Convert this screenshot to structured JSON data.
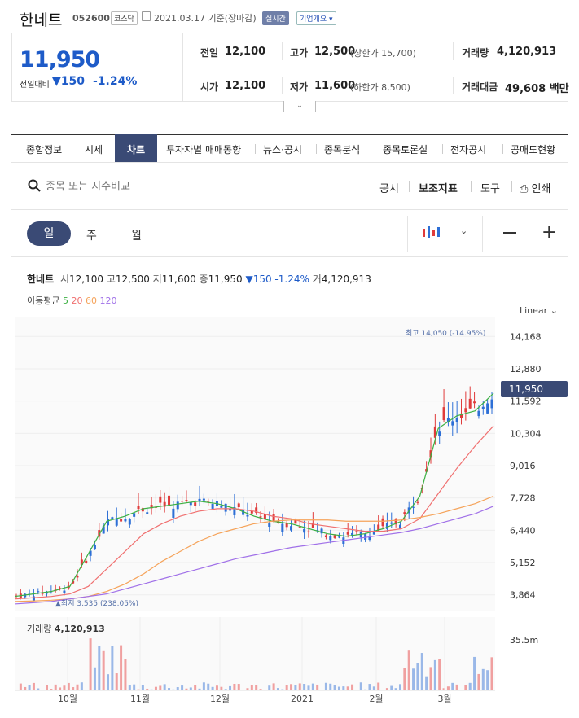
{
  "header": {
    "stock_name": "한네트",
    "stock_code": "052600",
    "market_badge": "코스닥",
    "date_text": "2021.03.17 기준(장마감)",
    "live_badge": "실시간",
    "overview_dropdown": "기업개요"
  },
  "price": {
    "current": "11,950",
    "change_label": "전일대비",
    "change_value": "150",
    "change_percent": "-1.24%"
  },
  "quote": {
    "prev_label": "전일",
    "prev_value": "12,100",
    "high_label": "고가",
    "high_value": "12,500",
    "upper_limit": "(상한가 15,700)",
    "volume_label": "거래량",
    "volume_value": "4,120,913",
    "open_label": "시가",
    "open_value": "12,100",
    "low_label": "저가",
    "low_value": "11,600",
    "lower_limit": "(하한가 8,500)",
    "amount_label": "거래대금",
    "amount_value": "49,608 백만"
  },
  "tabs": [
    {
      "label": "종합정보"
    },
    {
      "label": "시세"
    },
    {
      "label": "차트"
    },
    {
      "label": "투자자별 매매동향"
    },
    {
      "label": "뉴스·공시"
    },
    {
      "label": "종목분석"
    },
    {
      "label": "종목토론실"
    },
    {
      "label": "전자공시"
    },
    {
      "label": "공매도현황"
    }
  ],
  "toolbar": {
    "search_placeholder": "종목 또는 지수비교",
    "disclosure": "공시",
    "indicator": "보조지표",
    "tools": "도구",
    "print": "인쇄"
  },
  "period": {
    "day": "일",
    "week": "주",
    "month": "월"
  },
  "chart_info": {
    "name": "한네트",
    "open_label": "시",
    "open": "12,100",
    "high_label": "고",
    "high": "12,500",
    "low_label": "저",
    "low": "11,600",
    "close_label": "종",
    "close": "11,950",
    "change": "150",
    "change_pct": "-1.24%",
    "vol_label": "거",
    "vol": "4,120,913",
    "ma_label": "이동평균",
    "ma5": "5",
    "ma20": "20",
    "ma60": "60",
    "ma120": "120",
    "scale": "Linear",
    "max_label": "최고 14,050 (-14.95%)",
    "min_label": "최저 3,535 (238.05%)",
    "price_tag": "11,950",
    "volume_title": "거래량",
    "volume_value": "4,120,913",
    "volume_axis": "35.5m"
  },
  "colors": {
    "up": "#e03b3b",
    "down": "#2d6fd6",
    "ma5": "#3cb043",
    "ma20": "#f07070",
    "ma60": "#f5a35a",
    "ma120": "#a070e8",
    "accent": "#3a4a75"
  },
  "chart_data": {
    "type": "line",
    "title": "",
    "y_ticks": [
      "14,168",
      "12,880",
      "11,592",
      "10,304",
      "9,016",
      "7,728",
      "6,440",
      "5,152",
      "3,864"
    ],
    "x_ticks": [
      "10월",
      "11월",
      "12월",
      "2021",
      "2월",
      "3월"
    ],
    "ylim": [
      3400,
      14600
    ],
    "series": [
      {
        "name": "5",
        "values": [
          3800,
          3900,
          4000,
          4200,
          5500,
          6800,
          7000,
          7300,
          7400,
          7500,
          7600,
          7500,
          7300,
          7000,
          6800,
          6700,
          6500,
          6300,
          6200,
          6300,
          6500,
          6800,
          7800,
          10500,
          11000,
          11200,
          11900
        ]
      },
      {
        "name": "20",
        "values": [
          3700,
          3750,
          3800,
          3900,
          4200,
          4900,
          5600,
          6300,
          6700,
          7000,
          7200,
          7300,
          7300,
          7200,
          7000,
          6900,
          6700,
          6600,
          6500,
          6400,
          6400,
          6500,
          6900,
          7900,
          8900,
          9800,
          10600
        ]
      },
      {
        "name": "60",
        "values": [
          3600,
          3620,
          3650,
          3700,
          3800,
          4000,
          4300,
          4700,
          5200,
          5600,
          6000,
          6300,
          6500,
          6700,
          6800,
          6850,
          6850,
          6850,
          6800,
          6800,
          6800,
          6850,
          6950,
          7100,
          7300,
          7500,
          7800
        ]
      },
      {
        "name": "120",
        "values": [
          3500,
          3550,
          3600,
          3700,
          3800,
          3900,
          4100,
          4300,
          4500,
          4700,
          4900,
          5100,
          5300,
          5450,
          5600,
          5750,
          5850,
          5950,
          6050,
          6150,
          6250,
          6350,
          6500,
          6700,
          6900,
          7100,
          7400
        ]
      }
    ]
  }
}
